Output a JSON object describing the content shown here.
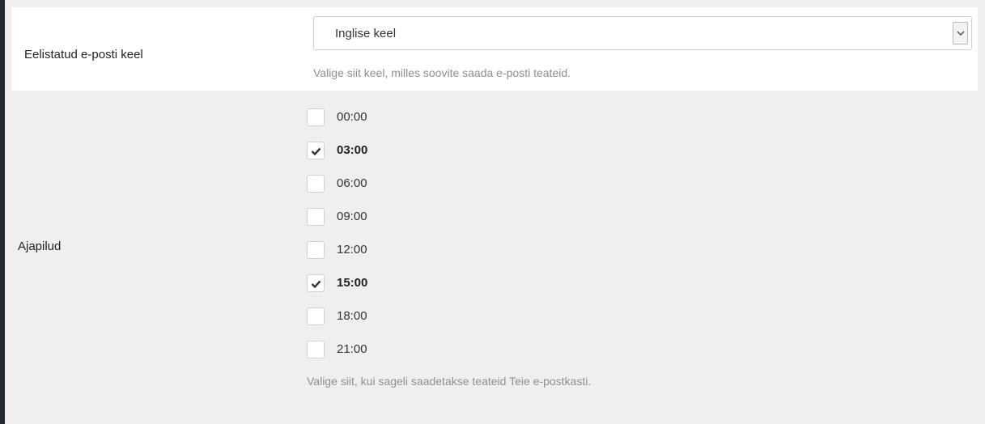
{
  "language_row": {
    "label": "Eelistatud e-posti keel",
    "selected": "Inglise keel",
    "help": "Valige siit keel, milles soovite saada e-posti teateid."
  },
  "time_row": {
    "label": "Ajapilud",
    "options": [
      {
        "label": "00:00",
        "checked": false
      },
      {
        "label": "03:00",
        "checked": true
      },
      {
        "label": "06:00",
        "checked": false
      },
      {
        "label": "09:00",
        "checked": false
      },
      {
        "label": "12:00",
        "checked": false
      },
      {
        "label": "15:00",
        "checked": true
      },
      {
        "label": "18:00",
        "checked": false
      },
      {
        "label": "21:00",
        "checked": false
      }
    ],
    "help": "Valige siit, kui sageli saadetakse teateid Teie e-postkasti."
  }
}
